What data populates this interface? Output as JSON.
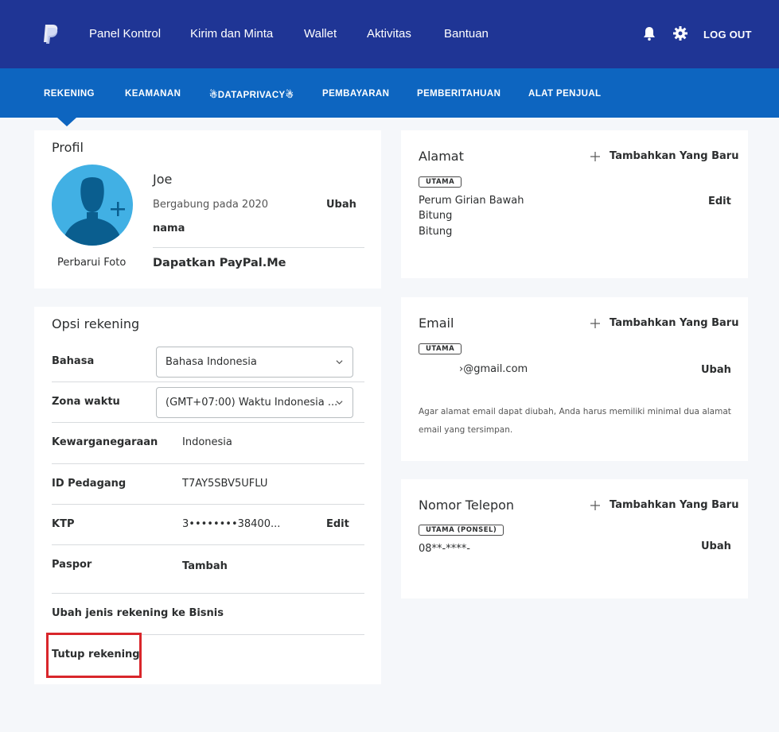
{
  "header": {
    "nav": [
      "Panel Kontrol",
      "Kirim dan Minta",
      "Wallet",
      "Aktivitas",
      "Bantuan"
    ],
    "logout": "LOG OUT",
    "icons": [
      "paypal-logo-icon",
      "bell-icon",
      "gear-icon"
    ]
  },
  "tabs": [
    "REKENING",
    "KEAMANAN",
    "☃DATAPRIVACY☃",
    "PEMBAYARAN",
    "PEMBERITAHUAN",
    "ALAT PENJUAL"
  ],
  "profile": {
    "title": "Profil",
    "name": "Joe",
    "joined": "Bergabung pada 2020",
    "change_name_1": "Ubah",
    "change_name_2": "nama",
    "update_photo": "Perbarui Foto",
    "paypal_me": "Dapatkan PayPal.Me"
  },
  "options": {
    "title": "Opsi rekening",
    "language_label": "Bahasa",
    "language_value": "Bahasa Indonesia",
    "timezone_label": "Zona waktu",
    "timezone_value": "(GMT+07:00) Waktu Indonesia ...",
    "citizenship_label": "Kewarganegaraan",
    "citizenship_value": "Indonesia",
    "merchant_label": "ID Pedagang",
    "merchant_value": "T7AY5SBV5UFLU",
    "ktp_label": "KTP",
    "ktp_value": "3••••••••38400...",
    "ktp_action": "Edit",
    "passport_label": "Paspor",
    "passport_action": "Tambah",
    "upgrade": "Ubah jenis rekening ke Bisnis",
    "close": "Tutup rekening"
  },
  "address": {
    "title": "Alamat",
    "add": "Tambahkan Yang Baru",
    "badge": "UTAMA",
    "line1": "Perum Girian Bawah",
    "line2": "Bitung",
    "line3": "Bitung",
    "action": "Edit"
  },
  "email": {
    "title": "Email",
    "add": "Tambahkan Yang Baru",
    "badge": "UTAMA",
    "value": "›@gmail.com",
    "action": "Ubah",
    "note1": "Agar alamat email dapat diubah, Anda harus memiliki minimal dua alamat",
    "note2": "email yang tersimpan."
  },
  "phone": {
    "title": "Nomor Telepon",
    "add": "Tambahkan Yang Baru",
    "badge": "UTAMA (PONSEL)",
    "value": "08**-****-",
    "action": "Ubah"
  },
  "colors": {
    "header": "#1f3595",
    "subnav": "#0d65c0",
    "link": "#0b6ba3",
    "avatar": "#41b0e4",
    "highlight": "#d9262b"
  }
}
